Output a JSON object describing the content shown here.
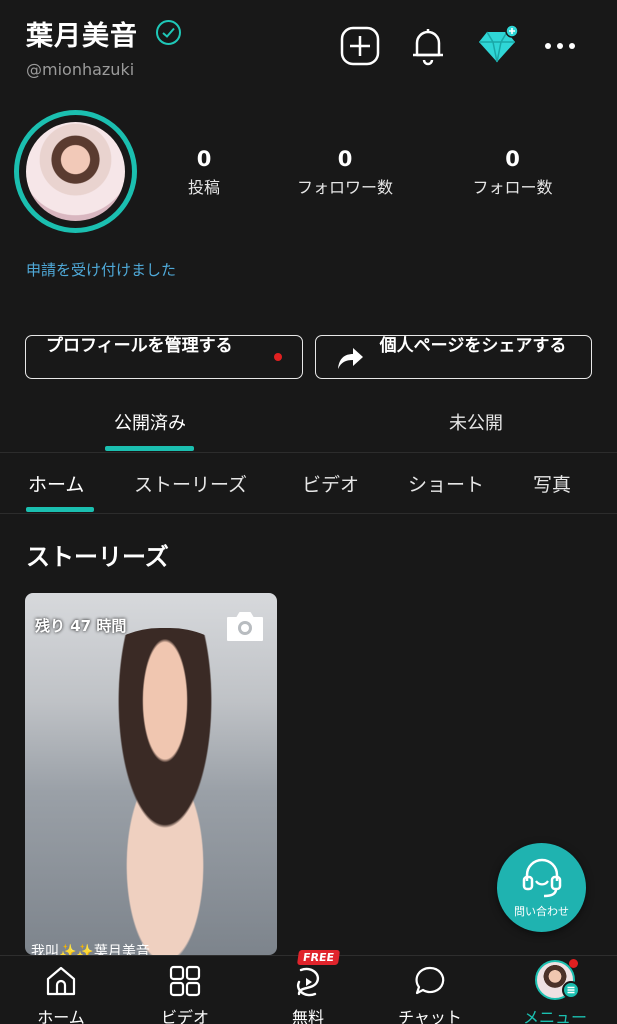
{
  "profile": {
    "display_name": "葉月美音",
    "handle": "@mionhazuki",
    "notice": "申請を受け付けました",
    "stats": [
      {
        "value": "0",
        "label": "投稿"
      },
      {
        "value": "0",
        "label": "フォロワー数"
      },
      {
        "value": "0",
        "label": "フォロー数"
      }
    ]
  },
  "header": {
    "icons": [
      "plus-square-icon",
      "bell-icon",
      "diamond-plus-icon",
      "more-icon"
    ]
  },
  "actions": {
    "manage_profile": "プロフィールを管理する",
    "share_page": "個人ページをシェアする"
  },
  "publish_tabs": [
    "公開済み",
    "未公開"
  ],
  "content_tabs": [
    "ホーム",
    "ストーリーズ",
    "ビデオ",
    "ショート",
    "写真"
  ],
  "section_title": "ストーリーズ",
  "story": {
    "time_left": "残り 47 時間",
    "caption": "我叫✨✨葉月美音"
  },
  "support": {
    "label": "問い合わせ"
  },
  "bottom_nav": [
    {
      "label": "ホーム",
      "icon": "home-icon"
    },
    {
      "label": "ビデオ",
      "icon": "grid-icon"
    },
    {
      "label": "無料",
      "icon": "play-swirl-icon",
      "badge": "FREE"
    },
    {
      "label": "チャット",
      "icon": "chat-icon"
    },
    {
      "label": "メニュー",
      "icon": "avatar-menu-icon"
    }
  ],
  "colors": {
    "accent": "#1bbfb0",
    "background": "#181818",
    "link": "#4fa9d8",
    "alert": "#e02020"
  }
}
